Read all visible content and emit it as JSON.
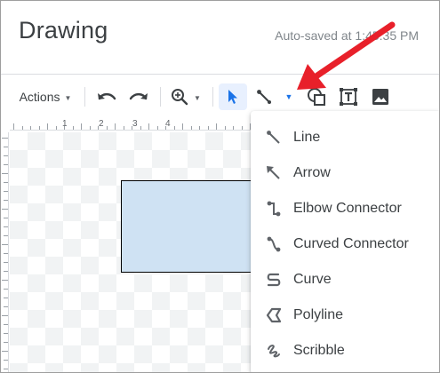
{
  "header": {
    "title": "Drawing",
    "autosave": "Auto-saved at 1:45:35 PM"
  },
  "toolbar": {
    "actions_label": "Actions",
    "buttons": [
      "undo-icon",
      "redo-icon",
      "zoom-icon",
      "select-icon",
      "line-icon",
      "shape-icon",
      "textbox-icon",
      "image-icon"
    ]
  },
  "ruler": {
    "labels": [
      "1",
      "2",
      "3",
      "4"
    ]
  },
  "line_menu": {
    "items": [
      {
        "label": "Line",
        "icon": "line-icon"
      },
      {
        "label": "Arrow",
        "icon": "arrow-icon"
      },
      {
        "label": "Elbow Connector",
        "icon": "elbow-connector-icon"
      },
      {
        "label": "Curved Connector",
        "icon": "curved-connector-icon"
      },
      {
        "label": "Curve",
        "icon": "curve-icon"
      },
      {
        "label": "Polyline",
        "icon": "polyline-icon"
      },
      {
        "label": "Scribble",
        "icon": "scribble-icon"
      }
    ]
  },
  "colors": {
    "accent": "#1a73e8",
    "shape_fill": "#cfe2f3",
    "annotation_arrow": "#e8202a",
    "icon": "#5f6368"
  }
}
